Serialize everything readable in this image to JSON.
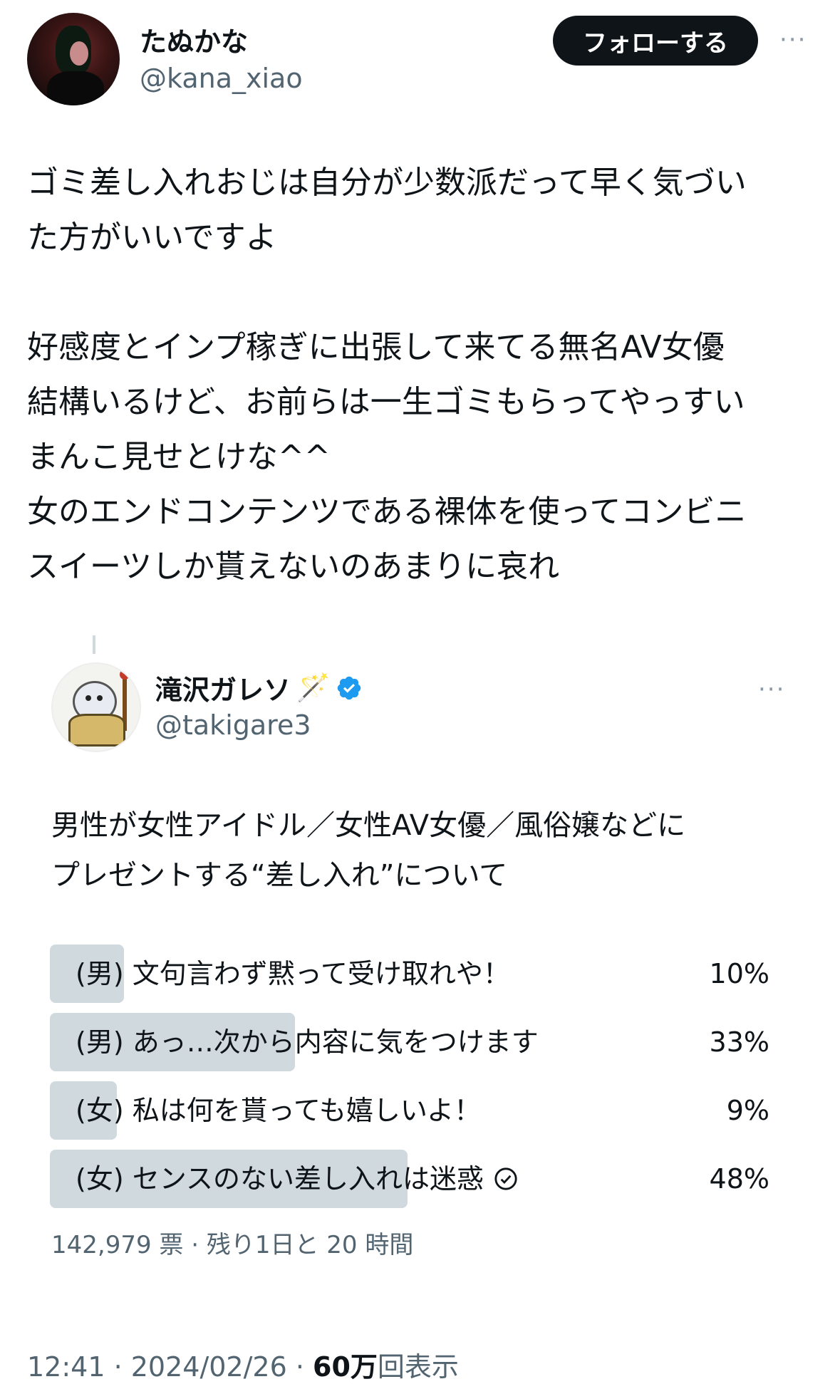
{
  "author": {
    "display_name": "たぬかな",
    "handle": "@kana_xiao",
    "follow_label": "フォローする",
    "more": "···"
  },
  "tweet": {
    "text": "ゴミ差し入れおじは自分が少数派だって早く気づい\nた方がいいですよ\n\n好感度とインプ稼ぎに出張して来てる無名AV女優\n結構いるけど、お前らは一生ゴミもらってやっすい\nまんこ見せとけな^^\n女のエンドコンテンツである裸体を使ってコンビニ\nスイーツしか貰えないのあまりに哀れ"
  },
  "quoted": {
    "display_name": "滝沢ガレソ",
    "name_emoji": "🪄",
    "handle": "@takigare3",
    "more": "···",
    "text": "男性が女性アイドル／女性AV女優／風俗嬢などに\nプレゼントする“差し入れ”について",
    "poll": {
      "options": [
        {
          "label": "(男) 文句言わず黙って受け取れや！",
          "percent": "10%",
          "value": 10
        },
        {
          "label": "(男) あっ…次から内容に気をつけます",
          "percent": "33%",
          "value": 33
        },
        {
          "label": "(女) 私は何を貰っても嬉しいよ！",
          "percent": "9%",
          "value": 9
        },
        {
          "label": "(女) センスのない差し入れは迷惑",
          "percent": "48%",
          "value": 48,
          "selected": true
        }
      ],
      "meta": "142,979 票 · 残り1日と 20 時間"
    }
  },
  "footer": {
    "time_date": "12:41 · 2024/02/26 · ",
    "views_count": "60万",
    "views_label": "回表示"
  },
  "colors": {
    "verified": "#1d9bf0",
    "poll_bar": "#cfd9de",
    "secondary_text": "#536471"
  }
}
